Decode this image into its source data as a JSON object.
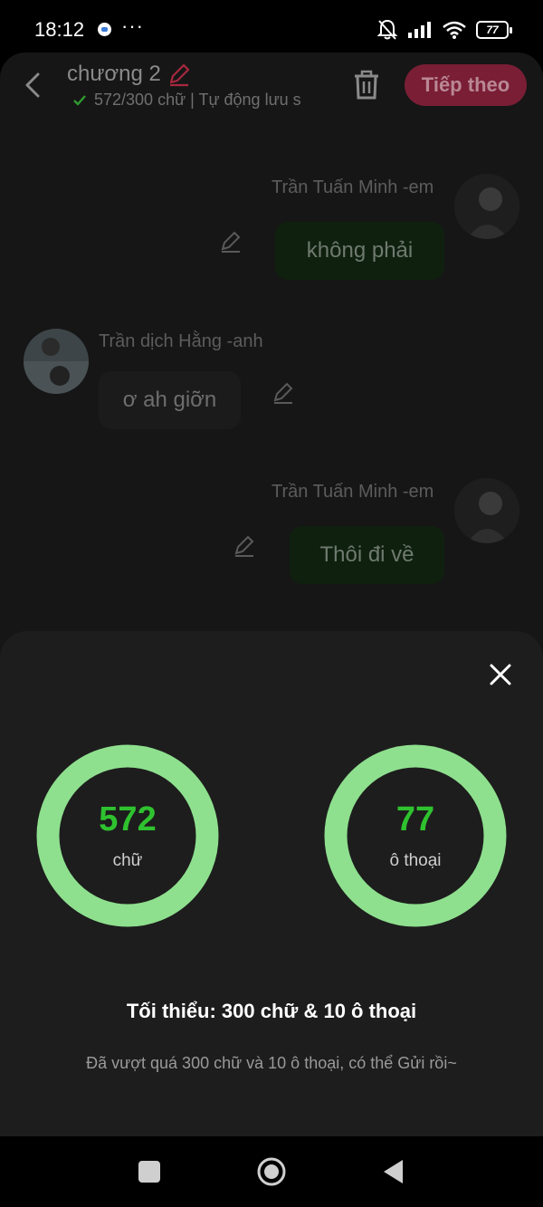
{
  "status_bar": {
    "time": "18:12",
    "more": "···",
    "battery": "77"
  },
  "header": {
    "title": "chương 2",
    "subtitle": "572/300 chữ | Tự động lưu s",
    "next_label": "Tiếp theo",
    "accent_color": "#7a1e36"
  },
  "messages": [
    {
      "sender": "Trần Tuấn Minh -em",
      "text": "không phải",
      "side": "right"
    },
    {
      "sender": "Trần dịch Hằng -anh",
      "text": "ơ ah giỡn",
      "side": "left"
    },
    {
      "sender": "Trần Tuấn Minh -em",
      "text": "Thôi đi về",
      "side": "right"
    }
  ],
  "stats": {
    "words": {
      "value": "572",
      "label": "chữ",
      "progress": 1.0
    },
    "dialogues": {
      "value": "77",
      "label": "ô thoại",
      "progress": 1.0
    },
    "ring_color": "#8ee08e",
    "value_color": "#2fc22f",
    "minimum": "Tối thiểu: 300 chữ & 10 ô thoại",
    "hint": "Đã vượt quá 300 chữ và 10 ô thoại, có thể Gửi rồi~"
  }
}
